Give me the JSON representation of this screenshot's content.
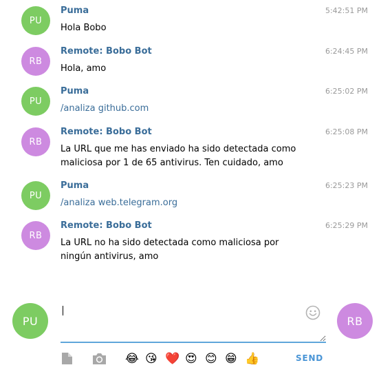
{
  "colors": {
    "puma_avatar": "#7dcc62",
    "bot_avatar": "#cd8ae0",
    "sender": "#3a6d99",
    "link": "#3a6d99",
    "timestamp": "#999999",
    "send": "#4a95d6",
    "input_underline": "#5ea6da"
  },
  "messages": [
    {
      "initials": "PU",
      "sender": "Puma",
      "time": "5:42:51 PM",
      "text": "Hola Bobo"
    },
    {
      "initials": "RB",
      "sender": "Remote: Bobo Bot",
      "time": "6:24:45 PM",
      "text": "Hola, amo"
    },
    {
      "initials": "PU",
      "sender": "Puma",
      "time": "6:25:02 PM",
      "command": "/analiza",
      "text": " github.com"
    },
    {
      "initials": "RB",
      "sender": "Remote: Bobo Bot",
      "time": "6:25:08 PM",
      "text": "La URL que me has enviado ha sido detectada como maliciosa por 1 de 65 antivirus. Ten cuidado, amo"
    },
    {
      "initials": "PU",
      "sender": "Puma",
      "time": "6:25:23 PM",
      "command": "/analiza",
      "text": " web.telegram.org"
    },
    {
      "initials": "RB",
      "sender": "Remote: Bobo Bot",
      "time": "6:25:29 PM",
      "text": "La URL no ha sido detectada como maliciosa por ningún antivirus, amo"
    }
  ],
  "composer": {
    "self_initials": "PU",
    "peer_initials": "RB",
    "input_value": "",
    "smiley_icon": "smiley-face-icon",
    "file_icon": "file-icon",
    "camera_icon": "camera-icon",
    "emojis": [
      {
        "name": "tears-of-joy-emoji-icon",
        "glyph": "😂"
      },
      {
        "name": "kissing-wink-emoji-icon",
        "glyph": "😘"
      },
      {
        "name": "heart-emoji-icon",
        "glyph": "❤️"
      },
      {
        "name": "heart-eyes-emoji-icon",
        "glyph": "😍"
      },
      {
        "name": "smiling-emoji-icon",
        "glyph": "😊"
      },
      {
        "name": "grinning-emoji-icon",
        "glyph": "😁"
      },
      {
        "name": "thumbs-up-emoji-icon",
        "glyph": "👍"
      }
    ],
    "send_label": "SEND"
  }
}
